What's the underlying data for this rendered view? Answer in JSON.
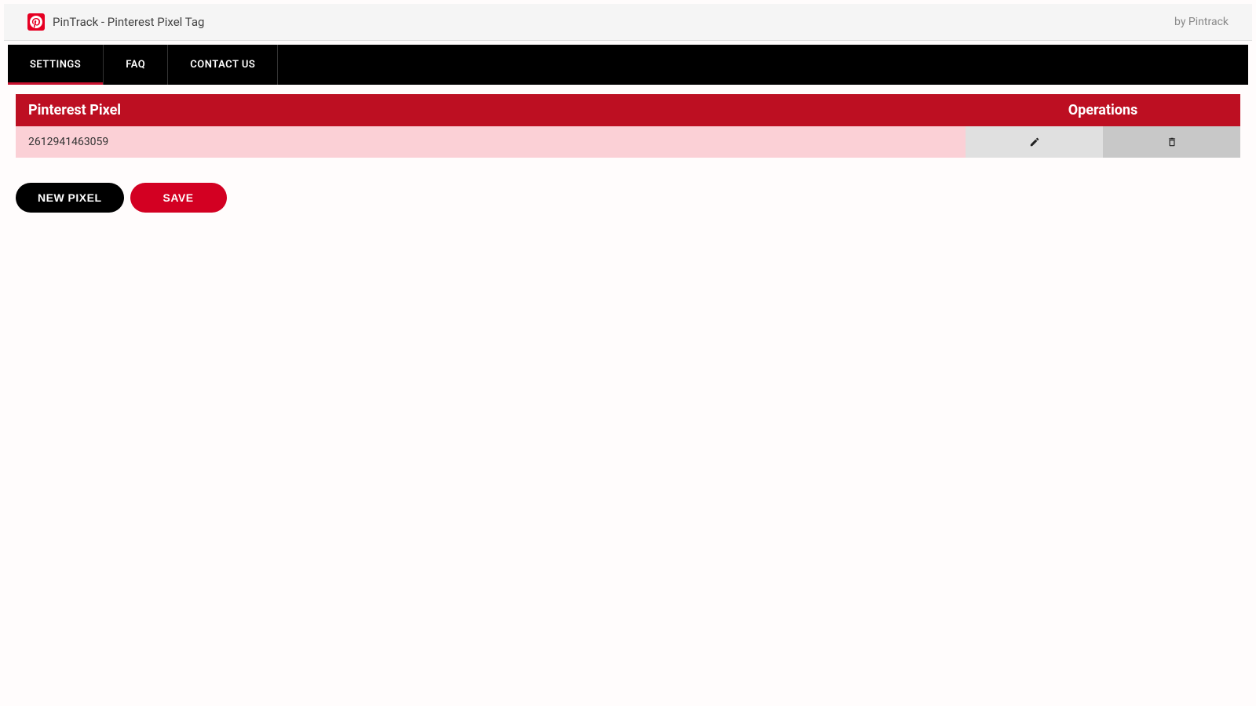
{
  "header": {
    "app_title": "PinTrack - Pinterest Pixel Tag",
    "by_text": "by Pintrack"
  },
  "nav": {
    "items": [
      {
        "label": "SETTINGS",
        "active": true
      },
      {
        "label": "FAQ",
        "active": false
      },
      {
        "label": "CONTACT US",
        "active": false
      }
    ]
  },
  "table": {
    "header_pixel": "Pinterest Pixel",
    "header_operations": "Operations",
    "rows": [
      {
        "pixel_id": "2612941463059"
      }
    ]
  },
  "buttons": {
    "new_pixel": "NEW PIXEL",
    "save": "SAVE"
  }
}
